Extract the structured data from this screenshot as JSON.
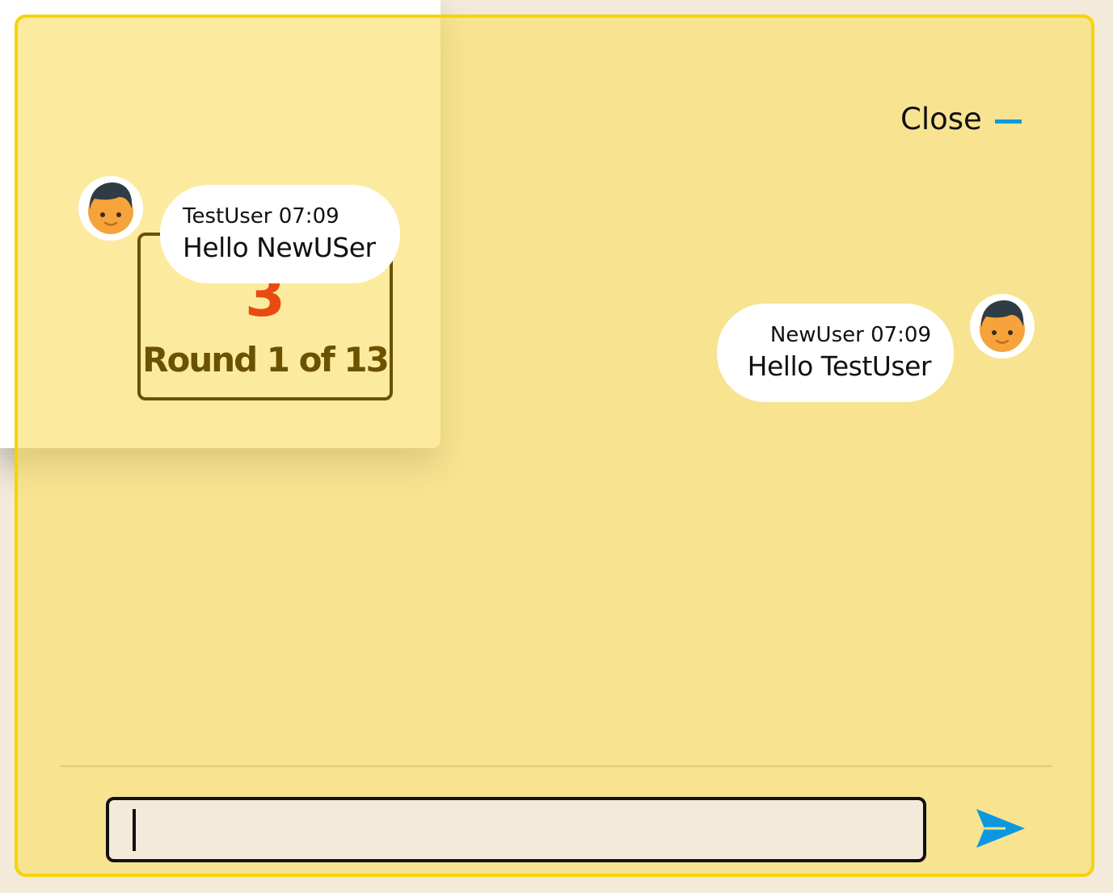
{
  "round": {
    "number": "3",
    "label": "Round 1 of 13"
  },
  "chat": {
    "close_label": "Close",
    "messages": [
      {
        "user": "TestUser",
        "time": "07:09",
        "meta": "TestUser 07:09",
        "text": "Hello NewUSer",
        "side": "left"
      },
      {
        "user": "NewUser",
        "time": "07:09",
        "meta": "NewUser 07:09",
        "text": "Hello TestUser",
        "side": "right"
      }
    ],
    "input": {
      "value": "",
      "placeholder": ""
    }
  },
  "icons": {
    "close": "minus-icon",
    "avatar": "user-avatar-icon",
    "send": "send-arrow-icon"
  },
  "colors": {
    "panel_border": "#f7d300",
    "accent_blue": "#0c98e0",
    "round_number": "#e84a10",
    "round_text": "#6b5200"
  }
}
